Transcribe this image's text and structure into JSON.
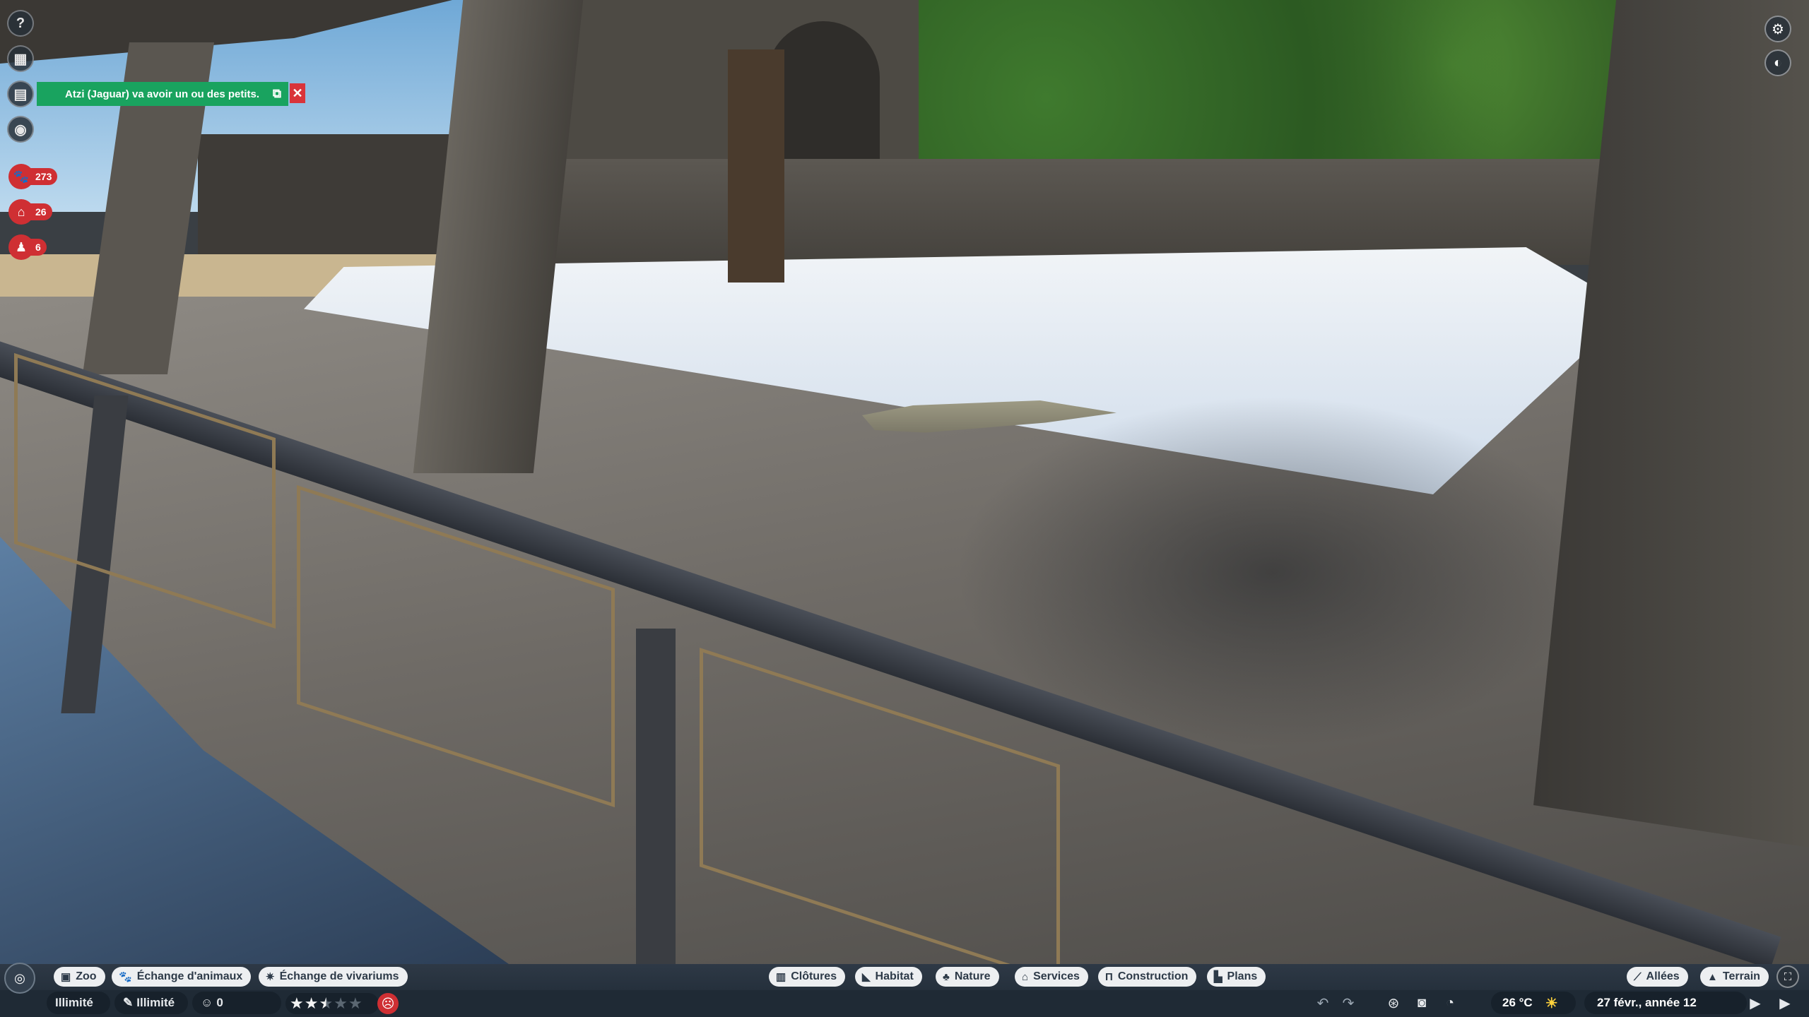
{
  "notification": {
    "message": "Atzi (Jaguar) va avoir un ou des petits.",
    "open_icon": "external-link-icon",
    "close_icon": "close-icon"
  },
  "side_menu": [
    {
      "name": "help-icon",
      "glyph": "?"
    },
    {
      "name": "animal-card-icon",
      "glyph": "▦"
    },
    {
      "name": "calendar-icon",
      "glyph": "▤"
    },
    {
      "name": "vision-icon",
      "glyph": "◉"
    }
  ],
  "stats": {
    "animals": "273",
    "habitats": "26",
    "staff": "6"
  },
  "toolbar": {
    "left_tabs": [
      {
        "label": "Zoo",
        "icon": "zoo-icon"
      },
      {
        "label": "Échange d'animaux",
        "icon": "paw-icon"
      },
      {
        "label": "Échange de vivariums",
        "icon": "vivarium-icon"
      }
    ],
    "center_tabs": [
      {
        "label": "Clôtures",
        "icon": "fence-icon"
      },
      {
        "label": "Habitat",
        "icon": "habitat-icon"
      },
      {
        "label": "Nature",
        "icon": "tree-icon"
      },
      {
        "label": "Services",
        "icon": "shop-icon"
      },
      {
        "label": "Construction",
        "icon": "building-icon"
      },
      {
        "label": "Plans",
        "icon": "blueprint-icon"
      }
    ],
    "right_tabs": [
      {
        "label": "Allées",
        "icon": "path-icon"
      },
      {
        "label": "Terrain",
        "icon": "terrain-icon"
      }
    ]
  },
  "status_bar": {
    "money": "Illimité",
    "research": "Illimité",
    "guests": "0",
    "zoo_rating": 2.5,
    "zoo_rating_max": 5,
    "temperature": "26 °C",
    "date": "27 févr., année 12"
  },
  "colors": {
    "notification_green": "#19a35f",
    "alert_red": "#cf2f33",
    "toolbar_bg": "#25303c",
    "pill_bg": "#edeff1"
  }
}
